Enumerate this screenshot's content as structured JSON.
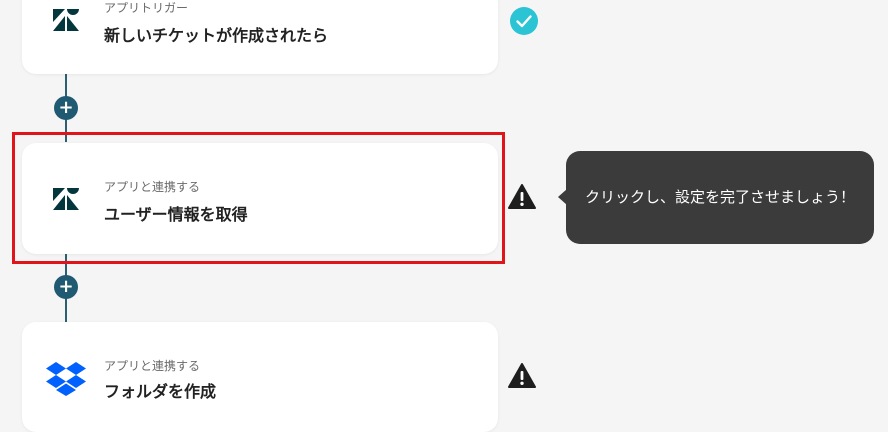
{
  "flow": {
    "steps": [
      {
        "subtitle": "アプリトリガー",
        "title": "新しいチケットが作成されたら",
        "app_icon": "zendesk-icon",
        "status": "complete"
      },
      {
        "subtitle": "アプリと連携する",
        "title": "ユーザー情報を取得",
        "app_icon": "zendesk-icon",
        "status": "warning"
      },
      {
        "subtitle": "アプリと連携する",
        "title": "フォルダを作成",
        "app_icon": "dropbox-icon",
        "status": "warning"
      }
    ],
    "add_step_label": "+"
  },
  "tooltip": {
    "text": "クリックし、設定を完了させましょう！"
  },
  "colors": {
    "connector": "#2d5f73",
    "add_button": "#1f5a72",
    "complete": "#2bc4d4",
    "warning": "#1e1e1e",
    "highlight": "#e0151c",
    "zendesk": "#03363d",
    "dropbox": "#0061fe"
  }
}
